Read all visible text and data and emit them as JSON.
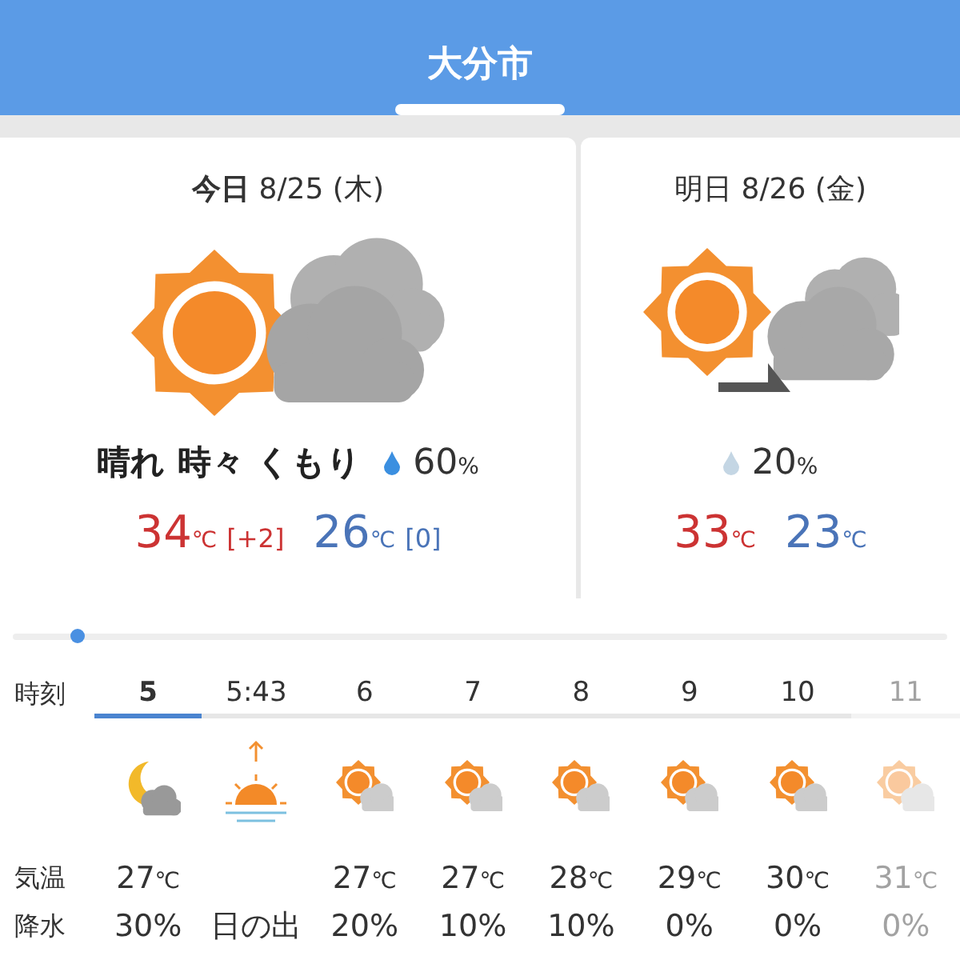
{
  "header": {
    "title": "大分市"
  },
  "days": [
    {
      "label": "今日",
      "date": "8/25",
      "weekday": "(木)",
      "kind": "sun-sometimes-cloud",
      "condition": "晴れ 時々 くもり",
      "rain": {
        "value": "60",
        "unit": "%",
        "color": "#3b8fe0"
      },
      "high": {
        "value": "34",
        "unit": "℃",
        "diff": "[+2]"
      },
      "low": {
        "value": "26",
        "unit": "℃",
        "diff": "[0]"
      }
    },
    {
      "label": "明日",
      "date": "8/26",
      "weekday": "(金)",
      "kind": "sun-then-cloud",
      "rain": {
        "value": "20",
        "unit": "%",
        "color": "#c4d6e4"
      },
      "high": {
        "value": "33",
        "unit": "℃"
      },
      "low": {
        "value": "23",
        "unit": "℃"
      }
    }
  ],
  "hourly": {
    "labels": [
      "時刻",
      "気温",
      "降水"
    ],
    "columns": [
      {
        "time": "5",
        "selected": true,
        "kind": "moon-cloud",
        "temp": "27",
        "temp_unit": "℃",
        "rain": "30%",
        "faded": false
      },
      {
        "time": "5:43",
        "selected": false,
        "kind": "sunrise",
        "rain": "日の出",
        "faded": false
      },
      {
        "time": "6",
        "selected": false,
        "kind": "sun-cloud",
        "temp": "27",
        "temp_unit": "℃",
        "rain": "20%",
        "faded": false
      },
      {
        "time": "7",
        "selected": false,
        "kind": "sun-cloud",
        "temp": "27",
        "temp_unit": "℃",
        "rain": "10%",
        "faded": false
      },
      {
        "time": "8",
        "selected": false,
        "kind": "sun-cloud",
        "temp": "28",
        "temp_unit": "℃",
        "rain": "10%",
        "faded": false
      },
      {
        "time": "9",
        "selected": false,
        "kind": "sun-cloud",
        "temp": "29",
        "temp_unit": "℃",
        "rain": "0%",
        "faded": false
      },
      {
        "time": "10",
        "selected": false,
        "kind": "sun-cloud",
        "temp": "30",
        "temp_unit": "℃",
        "rain": "0%",
        "faded": false
      },
      {
        "time": "11",
        "selected": false,
        "kind": "sun-cloud",
        "temp": "31",
        "temp_unit": "℃",
        "rain": "0%",
        "faded": true
      }
    ]
  }
}
